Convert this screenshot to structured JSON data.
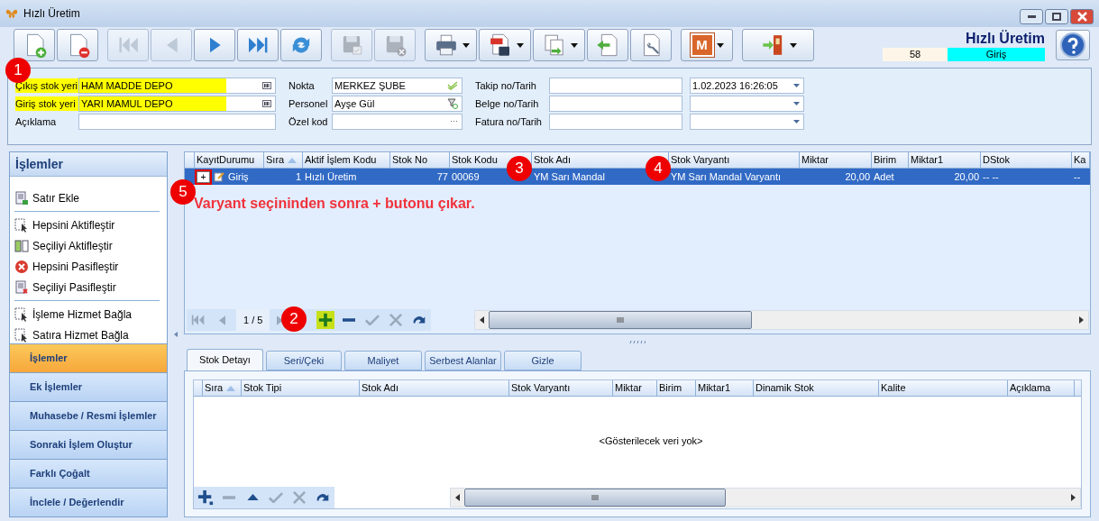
{
  "window": {
    "title": "Hızlı Üretim"
  },
  "toolbar": {
    "buttons": [
      {
        "kind": "new",
        "disabled": false,
        "dropdown": false
      },
      {
        "kind": "delete",
        "disabled": false,
        "dropdown": false
      },
      {
        "kind": "first",
        "disabled": true,
        "dropdown": false
      },
      {
        "kind": "prev",
        "disabled": true,
        "dropdown": false
      },
      {
        "kind": "next",
        "disabled": false,
        "dropdown": false
      },
      {
        "kind": "last",
        "disabled": false,
        "dropdown": false
      },
      {
        "kind": "refresh",
        "disabled": false,
        "dropdown": false
      },
      {
        "kind": "save",
        "disabled": true,
        "dropdown": false
      },
      {
        "kind": "save-cancel",
        "disabled": true,
        "dropdown": false
      },
      {
        "kind": "print",
        "disabled": false,
        "dropdown": true
      },
      {
        "kind": "pdf",
        "disabled": false,
        "dropdown": true
      },
      {
        "kind": "copy",
        "disabled": false,
        "dropdown": true
      },
      {
        "kind": "import",
        "disabled": false,
        "dropdown": false
      },
      {
        "kind": "tools",
        "disabled": false,
        "dropdown": false
      },
      {
        "kind": "m",
        "label": "M",
        "disabled": false,
        "dropdown": true
      },
      {
        "kind": "exit",
        "disabled": false,
        "dropdown": true
      }
    ],
    "title": "Hızlı Üretim",
    "record_no": "58",
    "direction": "Giriş"
  },
  "form": {
    "left": [
      {
        "label": "Çıkış stok yeri",
        "value": "HAM MADDE DEPO",
        "kind": "lookup",
        "highlighted": true
      },
      {
        "label": "Giriş stok yeri",
        "value": "YARI MAMUL DEPO",
        "kind": "lookup",
        "highlighted": true
      },
      {
        "label": "Açıklama",
        "kind": "text",
        "highlighted": false
      }
    ],
    "middle": [
      {
        "label": "Nokta",
        "value": "MERKEZ ŞUBE",
        "kind": "check"
      },
      {
        "label": "Personel",
        "value": "Ayşe Gül",
        "kind": "filter"
      },
      {
        "label": "Özel kod",
        "kind": "ellipsis",
        "button": "···"
      }
    ],
    "right": [
      {
        "label": "Takip no/Tarih",
        "date": "1.02.2023 16:26:05"
      },
      {
        "label": "Belge no/Tarih"
      },
      {
        "label": "Fatura no/Tarih"
      }
    ]
  },
  "side_panel": {
    "header": "İşlemler",
    "groups": [
      {
        "items": [
          {
            "label": "Satır Ekle",
            "kind": "add-row"
          }
        ]
      },
      {
        "items": [
          {
            "label": "Hepsini Aktifleştir",
            "kind": "cursor"
          },
          {
            "label": "Seçiliyi Aktifleştir",
            "kind": "activate"
          },
          {
            "label": "Hepsini Pasifleştir",
            "kind": "error"
          },
          {
            "label": "Seçiliyi Pasifleştir",
            "kind": "remove-row"
          }
        ]
      },
      {
        "items": [
          {
            "label": "İşleme Hizmet Bağla",
            "kind": "cursor"
          },
          {
            "label": "Satıra Hizmet Bağla",
            "kind": "cursor"
          }
        ]
      }
    ],
    "nav": [
      {
        "label": "İşlemler",
        "selected": true
      },
      {
        "label": "Ek İşlemler",
        "selected": false
      },
      {
        "label": "Muhasebe / Resmi İşlemler",
        "selected": false
      },
      {
        "label": "Sonraki İşlem Oluştur",
        "selected": false
      },
      {
        "label": "Farklı Çoğalt",
        "selected": false
      },
      {
        "label": "İnclele / Değerlendir",
        "selected": false
      }
    ]
  },
  "main_grid": {
    "columns": [
      {
        "label": "KayıtDurumu"
      },
      {
        "label": "Sıra",
        "sorted": true
      },
      {
        "label": "Aktif İşlem Kodu"
      },
      {
        "label": "Stok No"
      },
      {
        "label": "Stok Kodu"
      },
      {
        "label": "Stok Adı"
      },
      {
        "label": "Stok Varyantı"
      },
      {
        "label": "Miktar"
      },
      {
        "label": "Birim"
      },
      {
        "label": "Miktar1"
      },
      {
        "label": "DStok"
      },
      {
        "label": "Ka"
      }
    ],
    "rows": [
      {
        "selected": true,
        "expand_button": "+",
        "expand_marked": true,
        "cells": [
          "Giriş",
          "1",
          "Hızlı Üretim",
          "77",
          "00069",
          "YM Sarı Mandal",
          "YM Sarı Mandal Varyantı",
          "20,00",
          "Adet",
          "20,00",
          "-- --",
          "--"
        ]
      }
    ],
    "note": "Varyant seçininden sonra + butonu çıkar.",
    "navigator": {
      "position": "1 / 5",
      "buttons": [
        {
          "kind": "first",
          "disabled": true
        },
        {
          "kind": "prev",
          "disabled": true
        },
        {
          "kind": "next",
          "disabled": true
        },
        {
          "kind": "add",
          "disabled": false,
          "highlighted": true
        },
        {
          "kind": "remove",
          "disabled": false
        },
        {
          "kind": "check",
          "disabled": true
        },
        {
          "kind": "cancel",
          "disabled": true
        },
        {
          "kind": "redo",
          "disabled": false
        }
      ]
    }
  },
  "detail": {
    "tabs": [
      {
        "label": "Stok Detayı",
        "selected": true
      },
      {
        "label": "Seri/Çeki",
        "selected": false
      },
      {
        "label": "Maliyet",
        "selected": false
      },
      {
        "label": "Serbest Alanlar",
        "selected": false
      },
      {
        "label": "Gizle",
        "selected": false
      }
    ],
    "grid": {
      "columns": [
        {
          "label": "Sıra",
          "sorted": true
        },
        {
          "label": "Stok Tipi"
        },
        {
          "label": "Stok Adı"
        },
        {
          "label": "Stok Varyantı"
        },
        {
          "label": "Miktar"
        },
        {
          "label": "Birim"
        },
        {
          "label": "Miktar1"
        },
        {
          "label": "Dinamik Stok"
        },
        {
          "label": "Kalite"
        },
        {
          "label": "Açıklama"
        }
      ],
      "empty_message": "<Gösterilecek veri yok>",
      "navigator": {
        "buttons": [
          {
            "kind": "add-corner",
            "disabled": false
          },
          {
            "kind": "remove",
            "disabled": true
          },
          {
            "kind": "up",
            "disabled": false
          },
          {
            "kind": "check",
            "disabled": true
          },
          {
            "kind": "cancel",
            "disabled": true
          },
          {
            "kind": "redo",
            "disabled": false
          }
        ]
      }
    }
  },
  "annotations": [
    {
      "number": "1"
    },
    {
      "number": "2"
    },
    {
      "number": "3"
    },
    {
      "number": "4"
    },
    {
      "number": "5"
    }
  ]
}
